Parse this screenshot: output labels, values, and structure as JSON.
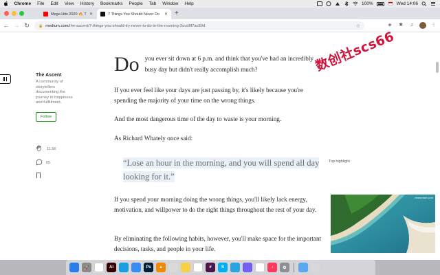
{
  "menubar": {
    "app": "Chrome",
    "items": [
      "File",
      "Edit",
      "View",
      "History",
      "Bookmarks",
      "People",
      "Tab",
      "Window",
      "Help"
    ],
    "battery": "100%",
    "clock": "Wed 14:06"
  },
  "tabs": [
    {
      "title": "Mega Hits 2020 🔥 The B",
      "favicon_color": "#ff0000"
    },
    {
      "title": "7 Things You Should Never Do",
      "favicon_color": "#111111"
    }
  ],
  "toolbar": {
    "url_host": "medium.com",
    "url_path": "/the-ascent/7-things-you-should-try-never-to-do-in-the-morning-2ocd8f7ac89d"
  },
  "sidebar": {
    "publication": "The Ascent",
    "description": "A community of storytellers documenting the journey to happiness and fulfillment.",
    "follow_label": "Follow",
    "claps": "11.5K",
    "responses": "65"
  },
  "article": {
    "drop_cap": "Do",
    "first_para": "you ever sit down at 6 p.m. and think that you've had an incredibly busy day but didn't really accomplish much?",
    "p2": "If you ever feel like your days are just passing by, it's likely because you're spending the majority of your time on the wrong things.",
    "p3": "And the most dangerous time of the day to waste is your morning.",
    "p4": "As Richard Whately once said:",
    "quote": "“Lose an hour in the morning, and you will spend all day looking for it.”",
    "top_highlight": "Top highlight",
    "p5": "If you spend your morning doing the wrong things, you'll likely lack energy, motivation, and willpower to do the right things throughout the rest of your day.",
    "p6": "By eliminating the following habits, however, you'll make space for the important decisions, tasks, and people in your life."
  },
  "pip": {
    "label": "remember.com"
  },
  "watermark": "数创社scs66",
  "dock": [
    {
      "name": "finder",
      "color": "#2b7de9",
      "glyph": ""
    },
    {
      "name": "launchpad",
      "color": "#8a8a8a",
      "glyph": "🚀"
    },
    {
      "name": "chrome",
      "color": "#ffffff",
      "glyph": ""
    },
    {
      "name": "illustrator",
      "color": "#330000",
      "glyph": "Ai"
    },
    {
      "name": "edge",
      "color": "#1b9de2",
      "glyph": ""
    },
    {
      "name": "safari",
      "color": "#3a8df0",
      "glyph": ""
    },
    {
      "name": "photoshop",
      "color": "#001e36",
      "glyph": "Ps"
    },
    {
      "name": "vlc",
      "color": "#f08a00",
      "glyph": "▲"
    },
    {
      "name": "preview",
      "color": "#d9d9d9",
      "glyph": ""
    },
    {
      "name": "notes",
      "color": "#f7d04a",
      "glyph": ""
    },
    {
      "name": "calendar",
      "color": "#ffffff",
      "glyph": "31"
    },
    {
      "name": "slack",
      "color": "#4a154b",
      "glyph": "#"
    },
    {
      "name": "skype",
      "color": "#00aff0",
      "glyph": "S"
    },
    {
      "name": "telegram",
      "color": "#2aa3e0",
      "glyph": ""
    },
    {
      "name": "viber",
      "color": "#7360f2",
      "glyph": ""
    },
    {
      "name": "chrome-2",
      "color": "#ffffff",
      "glyph": ""
    },
    {
      "name": "music",
      "color": "#fa3c5c",
      "glyph": "♪"
    },
    {
      "name": "system-preferences",
      "color": "#8e8e93",
      "glyph": "⚙"
    },
    {
      "name": "downloads",
      "color": "#5aa8f0",
      "glyph": ""
    },
    {
      "name": "trash",
      "color": "#d8d8dc",
      "glyph": ""
    }
  ]
}
